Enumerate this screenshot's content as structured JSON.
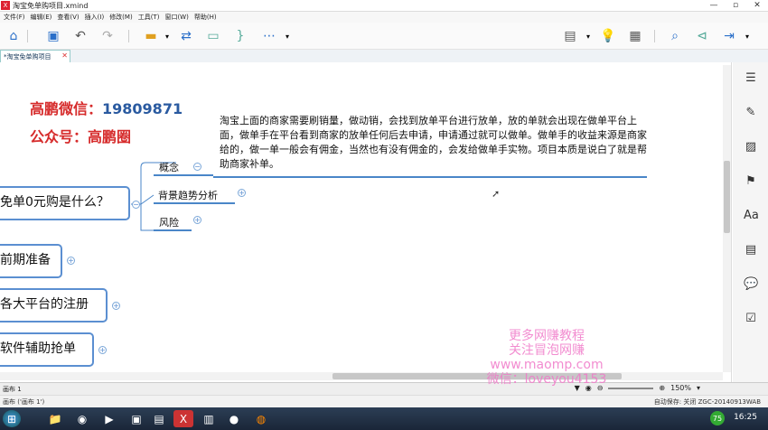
{
  "window": {
    "title": "淘宝免单购项目.xmind"
  },
  "menu": [
    "文件(F)",
    "编辑(E)",
    "查看(V)",
    "插入(I)",
    "修改(M)",
    "工具(T)",
    "窗口(W)",
    "帮助(H)"
  ],
  "doc_tab": "*淘宝免单购项目",
  "canvas": {
    "wechat_label": "高鹏微信：",
    "wechat_number": "19809871",
    "gzh_label": "公众号：高鹏圈",
    "description": "淘宝上面的商家需要刷销量，做动销，会找到放单平台进行放单，放的单就会出现在做单平台上面，做单手在平台看到商家的放单任何后去申请，申请通过就可以做单。做单手的收益来源是商家给的，做一单一般会有佣金，当然也有没有佣金的，会发给做单手实物。项目本质是说白了就是帮助商家补单。",
    "main_topic": "免单0元购是什么？",
    "subtopics": [
      "概念",
      "背景趋势分析",
      "风险"
    ],
    "topics": [
      "前期准备",
      "各大平台的注册",
      "软件辅助抢单"
    ]
  },
  "sheet_tab": "画布 1",
  "zoom": "150%",
  "status_left": "画布 ('画布 1')",
  "status_right": "自动保存: 关闭    ZGC-20140913WAB",
  "watermark": [
    "更多网赚教程",
    "关注冒泡网赚",
    "www.maomp.com",
    "微信：loveyou4153"
  ],
  "clock": "16:25",
  "tray_badge": "75"
}
